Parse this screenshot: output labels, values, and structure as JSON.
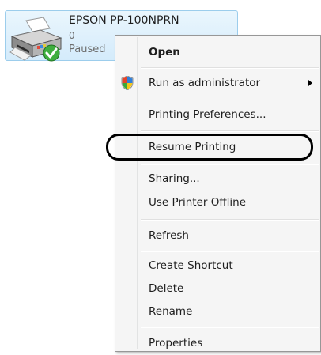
{
  "printer": {
    "name": "EPSON PP-100NPRN",
    "jobs": "0",
    "status": "Paused"
  },
  "context_menu": {
    "open": "Open",
    "run_as_admin": "Run as administrator",
    "printing_preferences": "Printing Preferences...",
    "resume_printing": "Resume Printing",
    "sharing": "Sharing...",
    "use_printer_offline": "Use Printer Offline",
    "refresh": "Refresh",
    "create_shortcut": "Create Shortcut",
    "delete": "Delete",
    "rename": "Rename",
    "properties": "Properties"
  },
  "icons": {
    "printer": "printer-icon",
    "status_check": "check-icon",
    "uac_shield": "uac-shield-icon",
    "submenu_arrow": "chevron-right-icon"
  },
  "colors": {
    "tile_border": "#9ccdec",
    "menu_background": "#f5f5f5",
    "menu_border": "#979797",
    "highlight_ring": "#000000"
  }
}
